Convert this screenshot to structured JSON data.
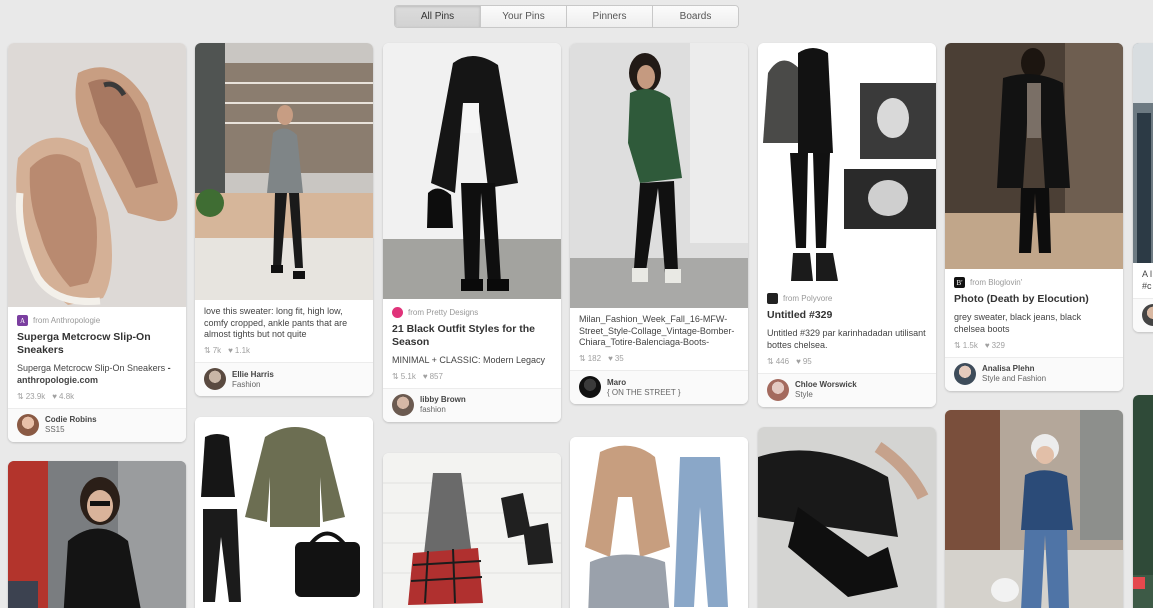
{
  "tabs": [
    {
      "label": "All Pins",
      "active": true
    },
    {
      "label": "Your Pins"
    },
    {
      "label": "Pinners"
    },
    {
      "label": "Boards"
    }
  ],
  "pins": [
    {
      "source_icon_letter": "A",
      "source": "from Anthropologie",
      "title": "Superga Metcrocw Slip-On Sneakers",
      "description": "Superga Metcrocw Slip-On Sneakers",
      "description_strong": "- anthropologie.com",
      "repins": "23.9k",
      "likes": "4.8k",
      "owner": "Codie Robins",
      "board": "SS15"
    },
    {
      "description": "love this sweater: long fit, high low, comfy cropped, ankle pants that are almost tights but not quite",
      "repins": "7k",
      "likes": "1.1k",
      "owner": "Ellie Harris",
      "board": "Fashion"
    },
    {
      "source": "from Pretty Designs",
      "title": "21 Black Outfit Styles for the Season",
      "description": "MINIMAL + CLASSIC: Modern Legacy",
      "repins": "5.1k",
      "likes": "857",
      "owner": "libby Brown",
      "board": "fashion"
    },
    {
      "description": "Milan_Fashion_Week_Fall_16-MFW-Street_Style-Collage_Vintage-Bomber-Chiara_Totire-Balenciaga-Boots-",
      "repins": "182",
      "likes": "35",
      "owner": "Maro",
      "board": "{ ON THE STREET }"
    },
    {
      "source": "from Polyvore",
      "title": "Untitled #329",
      "description": "Untitled #329 par karinhadadan utilisant bottes chelsea.",
      "repins": "446",
      "likes": "95",
      "owner": "Chloe Worswick",
      "board": "Style"
    },
    {
      "source_icon_letter": "B'",
      "source": "from Bloglovin'",
      "title": "Photo (Death by Elocution)",
      "description": "grey sweater, black jeans, black chelsea boots",
      "repins": "1.5k",
      "likes": "329",
      "owner": "Analisa Plehn",
      "board": "Style and Fashion"
    },
    {
      "description": "A l @c #c"
    }
  ],
  "colors": {
    "background": "#e9e9e9",
    "anthropologie": "#7b3fa0",
    "pretty_designs": "#e0337a",
    "polyvore": "#222222",
    "bloglovin": "#111111",
    "partial_badge": "#e5484d"
  }
}
